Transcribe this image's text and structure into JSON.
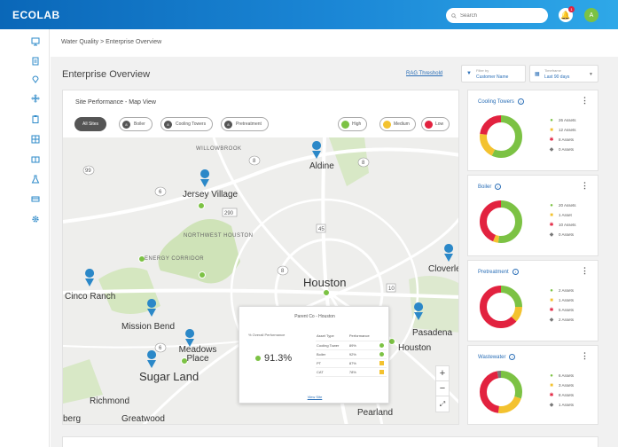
{
  "header": {
    "logo": "ECOLAB",
    "search_placeholder": "Search",
    "notification_count": "1",
    "avatar_initial": "A"
  },
  "breadcrumb": "Water Quality  >  Enterprise Overview",
  "page_title": "Enterprise Overview",
  "threshold_link": "RAG Threshold",
  "filters": [
    {
      "title": "Filter by",
      "value": "Customer Name"
    },
    {
      "title": "Timeframe",
      "value": "Last 90 days"
    }
  ],
  "map_card": {
    "title": "Site Performance - Map View",
    "view_chips": [
      {
        "num": "",
        "label": "All Sites"
      },
      {
        "num": "8",
        "label": "Boiler"
      },
      {
        "num": "8",
        "label": "Cooling Towers"
      },
      {
        "num": "8",
        "label": "Pretreatment"
      }
    ],
    "legend_chips": [
      {
        "label": "High",
        "color": "#7cc244"
      },
      {
        "label": "Medium",
        "color": "#f3c22f"
      },
      {
        "label": "Low",
        "color": "#e2223f"
      }
    ],
    "cities": [
      "Aldine",
      "WILLOWBROOK",
      "Jersey Village",
      "NORTHWEST HOUSTON",
      "ENERGY CORRIDOR",
      "Houston",
      "Cloverleaf",
      "Cinco Ranch",
      "Mission Bend",
      "Meadows Place",
      "Sugar Land",
      "Richmond",
      "Greatwood",
      "Pasadena",
      "Houston",
      "Pearland",
      "berg"
    ],
    "zoom_in": "+",
    "zoom_out": "−",
    "expand": "⤢"
  },
  "popup": {
    "title": "Parent Co - Houston",
    "overall_label": "% Overall Performance",
    "overall_value": "91.3%",
    "col_asset": "Asset Type",
    "col_perf": "Performance",
    "rows": [
      {
        "asset": "Cooling Tower",
        "perf": "89%",
        "mark": "g"
      },
      {
        "asset": "Boiler",
        "perf": "92%",
        "mark": "g"
      },
      {
        "asset": "PT",
        "perf": "87%",
        "mark": "y"
      },
      {
        "asset": "CAT",
        "perf": "78%",
        "mark": "y"
      }
    ],
    "link": "View Site"
  },
  "cards": [
    {
      "title": "Cooling Towers",
      "legend": [
        "26 Assets",
        "12 Assets",
        "8 Assets",
        "0 Assets"
      ],
      "slices": [
        0.57,
        0.2,
        0.23,
        0.0
      ]
    },
    {
      "title": "Boiler",
      "legend": [
        "20 Assets",
        "1 Asset",
        "10 Assets",
        "0 Assets"
      ],
      "slices": [
        0.52,
        0.04,
        0.44,
        0.0
      ]
    },
    {
      "title": "Pretreatment",
      "legend": [
        "2 Assets",
        "1 Assets",
        "5 Assets",
        "2 Assets"
      ],
      "slices": [
        0.25,
        0.12,
        0.63,
        0.0
      ]
    },
    {
      "title": "Wastewater",
      "legend": [
        "6 Assets",
        "3 Assets",
        "8 Assets",
        "1 Assets"
      ],
      "slices": [
        0.3,
        0.22,
        0.45,
        0.03
      ]
    }
  ],
  "colors": {
    "high": "#7cc244",
    "medium": "#f3c22f",
    "low": "#e2223f",
    "none": "#777777",
    "accent": "#2b6fb7"
  }
}
